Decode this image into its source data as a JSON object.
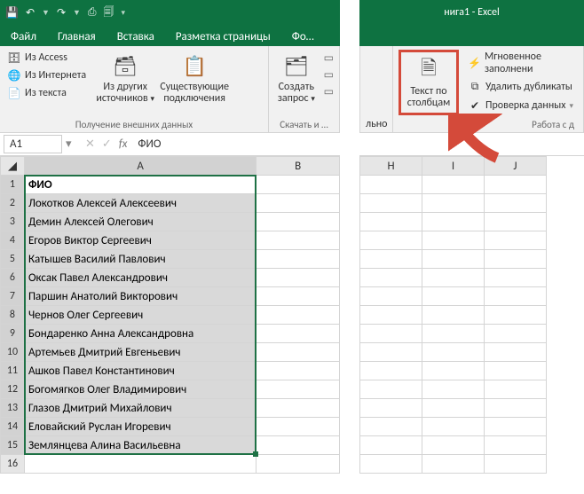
{
  "qat": {
    "save": "💾",
    "undo": "↶",
    "redo": "↷",
    "i1": "⎙",
    "i2": "🗐"
  },
  "title_right": "нига1 - Excel",
  "tabs": {
    "file": "Файл",
    "home": "Главная",
    "insert": "Вставка",
    "layout": "Разметка страницы",
    "formulas": "Фо…"
  },
  "ribbon_left": {
    "access": "Из Access",
    "web": "Из Интернета",
    "text": "Из текста",
    "other": "Из других источников",
    "existing": "Существующие подключения",
    "query": "Создать запрос",
    "group1": "Получение внешних данных",
    "group2": "Скачать и …"
  },
  "ribbon_right": {
    "txtonly": "льно",
    "texttocols": "Текст по столбцам",
    "flash": "Мгновенное заполнени",
    "dedup": "Удалить дубликаты",
    "valid": "Проверка данных",
    "group": "Работа с д"
  },
  "namebox": "A1",
  "fx": "fx",
  "formula": "ФИО",
  "cols_left": [
    "A",
    "B"
  ],
  "cols_right": [
    "H",
    "I",
    "J"
  ],
  "rows": [
    "ФИО",
    "Локотков Алексей Алексеевич",
    "Демин Алексей Олегович",
    "Егоров Виктор Сергеевич",
    "Катышев Василий Павлович",
    "Оксак Павел Александрович",
    "Паршин Анатолий Викторович",
    "Чернов Олег Сергеевич",
    "Бондаренко Анна Александровна",
    "Артемьев Дмитрий Евгеньевич",
    "Ашков Павел Константинович",
    "Богомягков Олег Владимирович",
    "Глазов Дмитрий Михайлович",
    "Еловайский Руслан Игоревич",
    "Землянцева Алина Васильевна",
    ""
  ]
}
